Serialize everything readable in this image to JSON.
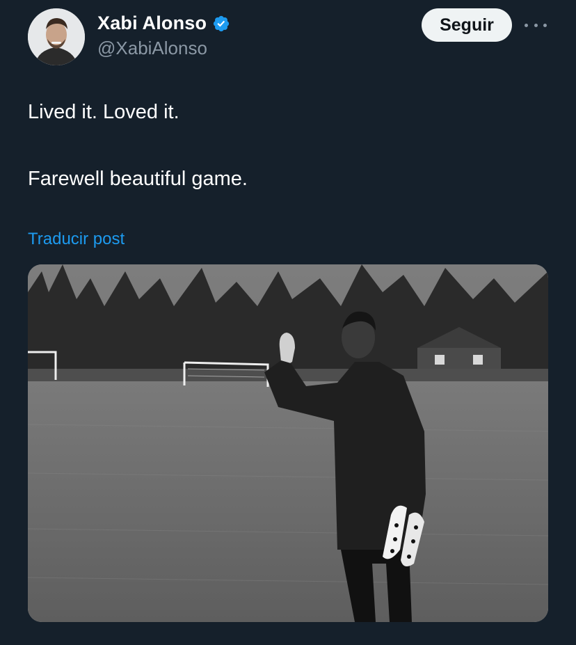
{
  "author": {
    "display_name": "Xabi Alonso",
    "handle": "@XabiAlonso",
    "verified": true,
    "verified_color": "#1d9bf0"
  },
  "actions": {
    "follow_label": "Seguir",
    "more_icon": "more-horizontal-icon"
  },
  "post": {
    "line1": "Lived it. Loved it.",
    "line2": "Farewell beautiful game.",
    "translate_label": "Traducir post"
  },
  "colors": {
    "background": "#15202b",
    "text": "#ffffff",
    "secondary_text": "#8b98a5",
    "link": "#1d9bf0"
  }
}
